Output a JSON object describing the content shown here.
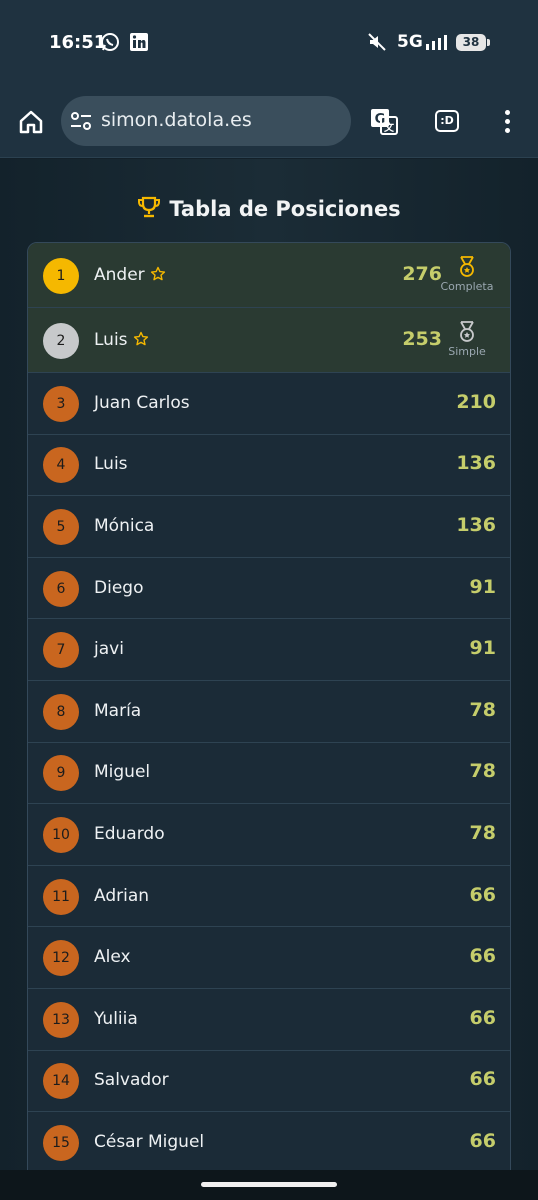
{
  "status_bar": {
    "time": "16:51",
    "network": "5G",
    "battery": "38",
    "icons": [
      "whatsapp-icon",
      "linkedin-icon",
      "mute-icon",
      "signal-icon"
    ]
  },
  "browser": {
    "url": "simon.datola.es",
    "extension_label": ":D"
  },
  "leaderboard": {
    "title": "Tabla de Posiciones",
    "accent_colors": {
      "gold": "#f5b800",
      "silver": "#c7c9cb",
      "bronze": "#c9661f",
      "score": "#c5cd6b"
    },
    "rows": [
      {
        "rank": "1",
        "name": "Ander",
        "score": "276",
        "medal": "Completa",
        "tier": "gold"
      },
      {
        "rank": "2",
        "name": "Luis",
        "score": "253",
        "medal": "Simple",
        "tier": "silver"
      },
      {
        "rank": "3",
        "name": "Juan Carlos",
        "score": "210",
        "tier": "bronze"
      },
      {
        "rank": "4",
        "name": "Luis",
        "score": "136",
        "tier": "bronze"
      },
      {
        "rank": "5",
        "name": "Mónica",
        "score": "136",
        "tier": "bronze"
      },
      {
        "rank": "6",
        "name": "Diego",
        "score": "91",
        "tier": "bronze"
      },
      {
        "rank": "7",
        "name": "javi",
        "score": "91",
        "tier": "bronze"
      },
      {
        "rank": "8",
        "name": "María",
        "score": "78",
        "tier": "bronze"
      },
      {
        "rank": "9",
        "name": "Miguel",
        "score": "78",
        "tier": "bronze"
      },
      {
        "rank": "10",
        "name": "Eduardo",
        "score": "78",
        "tier": "bronze"
      },
      {
        "rank": "11",
        "name": "Adrian",
        "score": "66",
        "tier": "bronze"
      },
      {
        "rank": "12",
        "name": "Alex",
        "score": "66",
        "tier": "bronze"
      },
      {
        "rank": "13",
        "name": "Yuliia",
        "score": "66",
        "tier": "bronze"
      },
      {
        "rank": "14",
        "name": "Salvador",
        "score": "66",
        "tier": "bronze"
      },
      {
        "rank": "15",
        "name": "César Miguel",
        "score": "66",
        "tier": "bronze"
      }
    ]
  }
}
